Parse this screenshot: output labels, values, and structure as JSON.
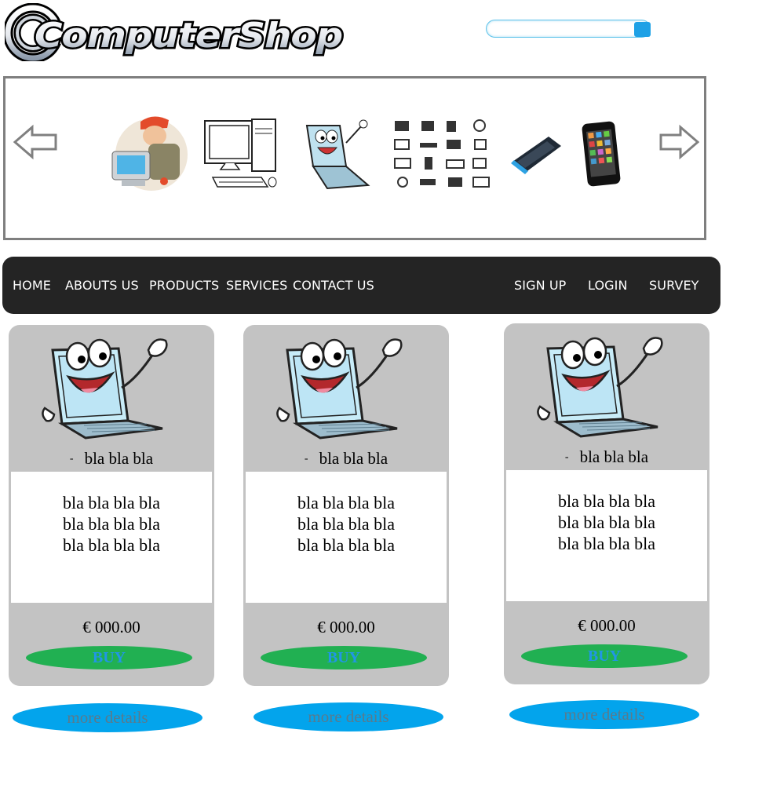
{
  "brand": {
    "name": "ComputerShop"
  },
  "search": {
    "placeholder": ""
  },
  "slider": {
    "items": [
      "technician",
      "desktop-computer",
      "laptop-mascot",
      "hardware-icons",
      "mobile-phone",
      "smartphone"
    ]
  },
  "nav": {
    "left": [
      "HOME",
      "ABOUTS US",
      "PRODUCTS",
      "SERVICES",
      "CONTACT US"
    ],
    "right": [
      "SIGN UP",
      "LOGIN",
      "SURVEY"
    ]
  },
  "products": [
    {
      "subtitle": "bla bla bla",
      "desc": [
        "bla bla bla bla",
        "bla bla bla bla",
        "bla bla bla bla"
      ],
      "price": "€ 000.00",
      "buy": "BUY",
      "more": "more details"
    },
    {
      "subtitle": "bla bla bla",
      "desc": [
        "bla bla bla bla",
        "bla bla bla bla",
        "bla bla bla bla"
      ],
      "price": "€ 000.00",
      "buy": "BUY",
      "more": "more details"
    },
    {
      "subtitle": "bla bla bla",
      "desc": [
        "bla bla bla bla",
        "bla bla bla bla",
        "bla bla bla bla"
      ],
      "price": "€ 000.00",
      "buy": "BUY",
      "more": "more details"
    }
  ],
  "colors": {
    "nav_bg": "#242424",
    "card_bg": "#c3c3c3",
    "buy_bg": "#21b052",
    "more_bg": "#03a4ec",
    "accent": "#1ea1e6"
  }
}
